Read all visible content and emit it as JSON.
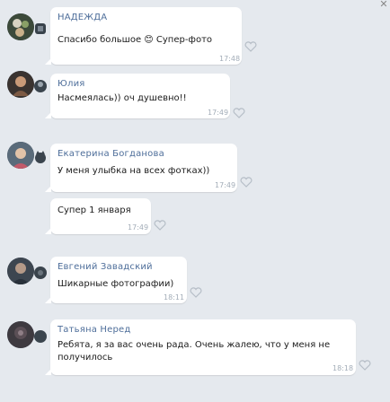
{
  "window": {
    "close_glyph": "✕"
  },
  "messages": [
    {
      "author": "НАДЕЖДА",
      "text": "Спасибо большое 😊 Супер-фото",
      "time": "17:48",
      "avatar_icon": "avatar-flowers-icon",
      "side_icon": "cube-icon"
    },
    {
      "author": "Юлия",
      "text": "Насмеялась)) оч душевно!!",
      "time": "17:49",
      "avatar_icon": "avatar-girl-icon",
      "side_icon": "hat-icon"
    },
    {
      "author": "Екатерина Богданова",
      "text": "У меня улыбка на всех фотках))",
      "time": "17:49",
      "avatar_icon": "avatar-woman-icon",
      "side_icon": "cat-icon"
    },
    {
      "author": "",
      "text": "Супер 1 января",
      "time": "17:49",
      "avatar_icon": "",
      "side_icon": ""
    },
    {
      "author": "Евгений Завадский",
      "text": "Шикарные фотографии)",
      "time": "18:11",
      "avatar_icon": "avatar-man-icon",
      "side_icon": "cup-icon"
    },
    {
      "author": "Татьяна Неред",
      "text": "Ребята, я за вас очень рада. Очень жалею, что у меня не получилось",
      "time": "18:18",
      "avatar_icon": "avatar-dark-icon",
      "side_icon": "orb-icon"
    }
  ],
  "colors": {
    "background": "#e5e9ee",
    "bubble": "#ffffff",
    "author": "#4e6e9a",
    "time": "#a3adb8"
  }
}
